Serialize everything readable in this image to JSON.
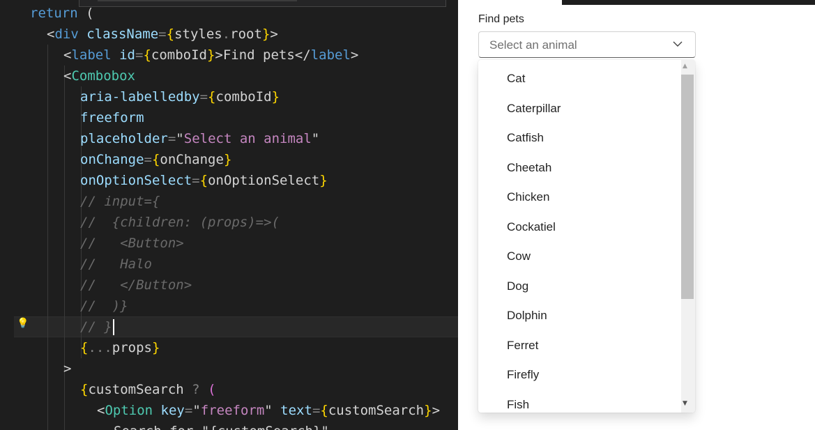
{
  "editor": {
    "lines": [
      [
        [
          "kw",
          "return"
        ],
        [
          "var",
          " ("
        ]
      ],
      [
        [
          "var",
          "<"
        ],
        [
          "tag",
          "div"
        ],
        [
          "attr",
          " className"
        ],
        [
          "op",
          "="
        ],
        [
          "br",
          "{"
        ],
        [
          "var",
          "styles"
        ],
        [
          "op",
          "."
        ],
        [
          "var",
          "root"
        ],
        [
          "br",
          "}"
        ],
        [
          "var",
          ">"
        ]
      ],
      [
        [
          "var",
          "<"
        ],
        [
          "tag",
          "label"
        ],
        [
          "attr",
          " id"
        ],
        [
          "op",
          "="
        ],
        [
          "br",
          "{"
        ],
        [
          "var",
          "comboId"
        ],
        [
          "br",
          "}"
        ],
        [
          "var",
          ">Find pets</"
        ],
        [
          "tag",
          "label"
        ],
        [
          "var",
          ">"
        ]
      ],
      [
        [
          "var",
          "<"
        ],
        [
          "comp",
          "Combobox"
        ]
      ],
      [
        [
          "attr",
          "aria-labelledby"
        ],
        [
          "op",
          "="
        ],
        [
          "br",
          "{"
        ],
        [
          "var",
          "comboId"
        ],
        [
          "br",
          "}"
        ]
      ],
      [
        [
          "attr",
          "freeform"
        ]
      ],
      [
        [
          "attr",
          "placeholder"
        ],
        [
          "op",
          "="
        ],
        [
          "var",
          "\""
        ],
        [
          "ph",
          "Select an animal"
        ],
        [
          "var",
          "\""
        ]
      ],
      [
        [
          "attr",
          "onChange"
        ],
        [
          "op",
          "="
        ],
        [
          "br",
          "{"
        ],
        [
          "var",
          "onChange"
        ],
        [
          "br",
          "}"
        ]
      ],
      [
        [
          "attr",
          "onOptionSelect"
        ],
        [
          "op",
          "="
        ],
        [
          "br",
          "{"
        ],
        [
          "var",
          "onOptionSelect"
        ],
        [
          "br",
          "}"
        ]
      ],
      [
        [
          "cm",
          "// input={"
        ]
      ],
      [
        [
          "cm",
          "//  {children: (props)=>("
        ]
      ],
      [
        [
          "cm",
          "//   <Button>"
        ]
      ],
      [
        [
          "cm",
          "//   Halo"
        ]
      ],
      [
        [
          "cm",
          "//   </Button>"
        ]
      ],
      [
        [
          "cm",
          "//  )}"
        ]
      ],
      [
        [
          "cm",
          "// }"
        ]
      ],
      [
        [
          "br",
          "{"
        ],
        [
          "op",
          "..."
        ],
        [
          "var",
          "props"
        ],
        [
          "br",
          "}"
        ]
      ],
      [
        [
          "var",
          ">"
        ]
      ],
      [
        [
          "br",
          "{"
        ],
        [
          "var",
          "customSearch"
        ],
        [
          "op",
          " ? "
        ],
        [
          "br2",
          "("
        ]
      ],
      [
        [
          "var",
          "<"
        ],
        [
          "comp",
          "Option"
        ],
        [
          "attr",
          " key"
        ],
        [
          "op",
          "="
        ],
        [
          "var",
          "\""
        ],
        [
          "ph",
          "freeform"
        ],
        [
          "var",
          "\""
        ],
        [
          "attr",
          " text"
        ],
        [
          "op",
          "="
        ],
        [
          "br",
          "{"
        ],
        [
          "var",
          "customSearch"
        ],
        [
          "br",
          "}"
        ],
        [
          "var",
          ">"
        ]
      ],
      [
        [
          "var",
          "Search for \"{customSearch}\""
        ]
      ]
    ]
  },
  "preview": {
    "label": "Find pets",
    "combobox": {
      "placeholder": "Select an animal"
    },
    "options": [
      "Cat",
      "Caterpillar",
      "Catfish",
      "Cheetah",
      "Chicken",
      "Cockatiel",
      "Cow",
      "Dog",
      "Dolphin",
      "Ferret",
      "Firefly",
      "Fish"
    ]
  },
  "icons": {
    "lightbulb": "lightbulb-icon",
    "chevron": "chevron-down-icon"
  },
  "colors": {
    "editor_bg": "#1e1e1e",
    "keyword": "#569cd6",
    "component": "#4ec9b0",
    "attribute": "#9cdcfe",
    "comment": "#6a6a6a",
    "lightbulb": "#ffcc00"
  }
}
